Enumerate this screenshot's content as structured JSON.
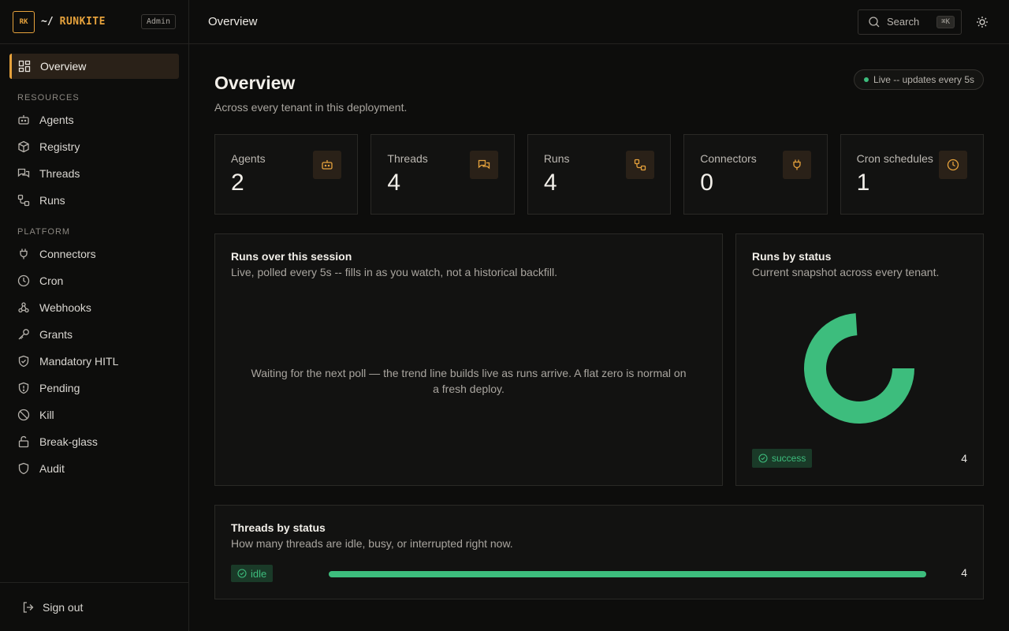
{
  "brand": {
    "logo": "RK",
    "prefix": "~/",
    "name": "RUNKITE",
    "badge": "Admin"
  },
  "sidebar": {
    "active": {
      "label": "Overview",
      "icon": "dashboard-icon"
    },
    "sections": [
      {
        "title": "RESOURCES",
        "items": [
          {
            "label": "Agents",
            "icon": "bot-icon"
          },
          {
            "label": "Registry",
            "icon": "package-icon"
          },
          {
            "label": "Threads",
            "icon": "chat-icon"
          },
          {
            "label": "Runs",
            "icon": "workflow-icon"
          }
        ]
      },
      {
        "title": "PLATFORM",
        "items": [
          {
            "label": "Connectors",
            "icon": "plug-icon"
          },
          {
            "label": "Cron",
            "icon": "clock-icon"
          },
          {
            "label": "Webhooks",
            "icon": "webhook-icon"
          },
          {
            "label": "Grants",
            "icon": "key-icon"
          },
          {
            "label": "Mandatory HITL",
            "icon": "shield-check-icon"
          },
          {
            "label": "Pending",
            "icon": "shield-alert-icon"
          },
          {
            "label": "Kill",
            "icon": "ban-icon"
          },
          {
            "label": "Break-glass",
            "icon": "unlock-icon"
          },
          {
            "label": "Audit",
            "icon": "shield-icon"
          }
        ]
      }
    ],
    "signout": "Sign out"
  },
  "topbar": {
    "title": "Overview",
    "search": "Search",
    "shortcut": "⌘K"
  },
  "page": {
    "title": "Overview",
    "subtitle": "Across every tenant in this deployment.",
    "live": "Live -- updates every 5s"
  },
  "stats": [
    {
      "label": "Agents",
      "value": "2",
      "icon": "bot-icon"
    },
    {
      "label": "Threads",
      "value": "4",
      "icon": "chat-icon"
    },
    {
      "label": "Runs",
      "value": "4",
      "icon": "workflow-icon"
    },
    {
      "label": "Connectors",
      "value": "0",
      "icon": "plug-icon"
    },
    {
      "label": "Cron schedules",
      "value": "1",
      "icon": "clock-icon"
    }
  ],
  "runs_session": {
    "title": "Runs over this session",
    "subtitle": "Live, polled every 5s -- fills in as you watch, not a historical backfill.",
    "empty": "Waiting for the next poll — the trend line builds live as runs arrive. A flat zero is normal on a fresh deploy."
  },
  "runs_status": {
    "title": "Runs by status",
    "subtitle": "Current snapshot across every tenant.",
    "legend_label": "success",
    "legend_count": "4"
  },
  "threads_status": {
    "title": "Threads by status",
    "subtitle": "How many threads are idle, busy, or interrupted right now.",
    "label": "idle",
    "count": "4",
    "fill": 1.0
  },
  "colors": {
    "accent": "#e6a23c",
    "success": "#3dbd7d"
  },
  "chart_data": {
    "type": "pie",
    "categories": [
      "success"
    ],
    "values": [
      4
    ]
  }
}
